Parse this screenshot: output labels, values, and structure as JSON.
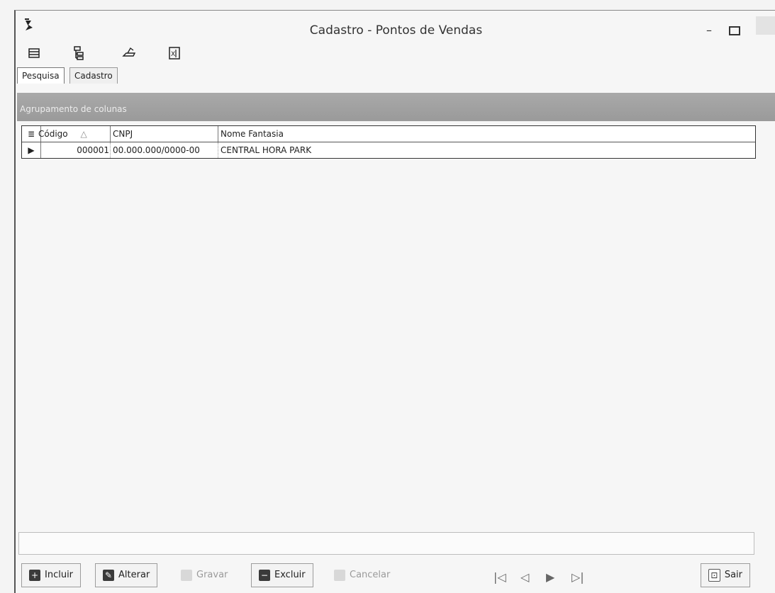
{
  "window": {
    "title": "Cadastro - Pontos de Vendas"
  },
  "toolbar": {
    "items": [
      {
        "icon": "print-preview-icon"
      },
      {
        "icon": "tree-icon"
      },
      {
        "icon": "print-icon"
      },
      {
        "icon": "excel-icon"
      }
    ]
  },
  "tabs": [
    {
      "label": "Pesquisa"
    },
    {
      "label": "Cadastro"
    }
  ],
  "group_bar": {
    "text": "Agrupamento de colunas"
  },
  "grid": {
    "columns": [
      "Código",
      "CNPJ",
      "Nome Fantasia"
    ],
    "rows": [
      {
        "codigo": "000001",
        "cnpj": "00.000.000/0000-00",
        "nome": "CENTRAL HORA PARK"
      }
    ]
  },
  "buttons": {
    "incluir": "Incluir",
    "alterar": "Alterar",
    "gravar": "Gravar",
    "excluir": "Excluir",
    "cancelar": "Cancelar",
    "sair": "Sair"
  },
  "nav": {
    "first": "|◁",
    "prev": "◁",
    "next": "▶",
    "last": "▷|"
  }
}
